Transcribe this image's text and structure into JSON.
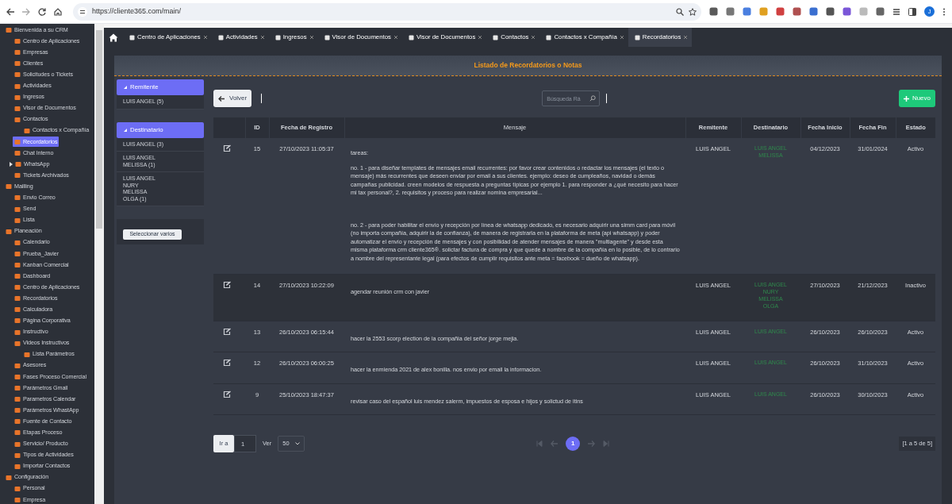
{
  "browser": {
    "url": "https://cliente365.com/main/",
    "profile": "J"
  },
  "sidebar": {
    "items": [
      {
        "label": "Bienvenida a su CRM",
        "selected": false,
        "expanded": true,
        "children": [
          {
            "label": "Centro de Aplicaciones",
            "selected": false
          },
          {
            "label": "Empresas",
            "selected": false
          },
          {
            "label": "Clientes",
            "selected": false
          },
          {
            "label": "Solicitudes o Tickets",
            "selected": false
          },
          {
            "label": "Actividades",
            "selected": false
          },
          {
            "label": "Ingresos",
            "selected": false
          },
          {
            "label": "Visor de Documentos",
            "selected": false
          },
          {
            "label": "Contactos",
            "selected": false,
            "expanded": true,
            "children": [
              {
                "label": "Contactos x Compañía",
                "selected": false
              }
            ]
          },
          {
            "label": "Recordatorios",
            "selected": true
          },
          {
            "label": "Chat Interno",
            "selected": false
          },
          {
            "label": "WhatsApp",
            "selected": false,
            "expanded": false
          },
          {
            "label": "Tickets Archivados",
            "selected": false
          }
        ]
      },
      {
        "label": "Mailling",
        "selected": false,
        "expanded": true,
        "children": [
          {
            "label": "Envio Correo",
            "selected": false
          },
          {
            "label": "Send",
            "selected": false
          },
          {
            "label": "Lista",
            "selected": false
          }
        ]
      },
      {
        "label": "Planeación",
        "selected": false,
        "expanded": true,
        "children": [
          {
            "label": "Calendario",
            "selected": false
          },
          {
            "label": "Prueba_Javier",
            "selected": false
          },
          {
            "label": "Kanban Comercial",
            "selected": false
          },
          {
            "label": "Dashboard",
            "selected": false
          },
          {
            "label": "Centro de Aplicaciones",
            "selected": false
          },
          {
            "label": "Recordatorios",
            "selected": false
          },
          {
            "label": "Calculadora",
            "selected": false
          },
          {
            "label": "Página Corporativa",
            "selected": false
          },
          {
            "label": "Instructivo",
            "selected": false
          },
          {
            "label": "Videos Instructivos",
            "selected": false,
            "expanded": true,
            "children": [
              {
                "label": "Lista Parámetros",
                "selected": false
              }
            ]
          },
          {
            "label": "Asesores",
            "selected": false
          },
          {
            "label": "Fases Proceso Comercial",
            "selected": false
          },
          {
            "label": "Parámetros Gmail",
            "selected": false
          },
          {
            "label": "Parametros Calendar",
            "selected": false
          },
          {
            "label": "Parámetros WhastApp",
            "selected": false
          },
          {
            "label": "Fuente de Contacto",
            "selected": false
          },
          {
            "label": "Etapas Proceso",
            "selected": false
          },
          {
            "label": "Servicio/ Producto",
            "selected": false
          },
          {
            "label": "Tipos de Actividades",
            "selected": false
          },
          {
            "label": "Importar Contactos",
            "selected": false
          }
        ]
      },
      {
        "label": "Configuración",
        "selected": false,
        "expanded": true,
        "children": [
          {
            "label": "Personal",
            "selected": false
          },
          {
            "label": "Empresa",
            "selected": false
          }
        ]
      }
    ]
  },
  "tabs": [
    {
      "label": "Centro de Aplicaciones",
      "selected": false
    },
    {
      "label": "Actividades",
      "selected": false
    },
    {
      "label": "Ingresos",
      "selected": false
    },
    {
      "label": "Visor de Documentos",
      "selected": false
    },
    {
      "label": "Visor de Documentos",
      "selected": false
    },
    {
      "label": "Contactos",
      "selected": false
    },
    {
      "label": "Contactos x Compañía",
      "selected": false
    },
    {
      "label": "Recordatorios",
      "selected": true
    }
  ],
  "panel_title": "Listado de Recordatorios o Notas",
  "filters": [
    {
      "title": "Remitente",
      "items": [
        "LUIS ANGEL  (5)"
      ]
    },
    {
      "title": "Destinatario",
      "items": [
        "LUIS ANGEL  (3)",
        "LUIS ANGEL\nMELISSA  (1)",
        "LUIS ANGEL\nNURY\nMELISSA\nOLGA  (1)"
      ]
    }
  ],
  "select_many_button": "Seleccionar varios",
  "back_button": "Volver",
  "search": {
    "placeholder": "Búsqueda Rá"
  },
  "new_button": "Nuevo",
  "table": {
    "columns": [
      "ID",
      "Fecha de Registro",
      "Mensaje",
      "Remitente",
      "Destinatario",
      "Fecha Inicio",
      "Fecha Fin",
      "Estado"
    ],
    "rows": [
      {
        "selected": false,
        "id": "15",
        "fecha_registro": "27/10/2023 11:05:37",
        "mensaje": [
          "tareas:",
          "no. 1 - para diseñar templates de mensajes email recurrentes: por favor crear contenidos o redactar los mensajes (el texto o mensaje)  más recurrentes que deseen enviar por email a sus clientes. ejemplo: deseo de cumpleaños, navidad o demás campañas publicidad. creen modelos de respuesta a preguntas típicas por ejemplo 1. para responder a ¿qué necesito para hacer mi tax personal?, 2. requisitos y proceso para realizar nomina empresarial...",
          "no. 2 - para poder habilitar el envío y recepción por línea de whatsapp dedicado, es necesario adquirir una simm card para móvil (no importa compañía, adquirir la de confianza), de manera de registrarla en la plataforma de meta (api whatsapp) y poder automatizar el envío y recepción de mensajes y con posibilidad de atender mensajes de manera \"multiagente\" y desde esta misma plataforma crm cliente365®. solictar factura de compra y que quede a nombre de la compañía en lo posible, de lo contrario a nombre del representante legal (para efectos de cumplir requisitos ante meta = facebook = dueño de  whatsapp)."
        ],
        "remitente": "LUIS ANGEL",
        "destinatario": [
          "LUIS ANGEL",
          "MELISSA"
        ],
        "fecha_inicio": "04/12/2023",
        "fecha_fin": "31/01/2024",
        "estado": "Activo"
      },
      {
        "selected": true,
        "id": "14",
        "fecha_registro": "27/10/2023 10:22:09",
        "mensaje": [
          "agendar reunión crm con javier"
        ],
        "remitente": "LUIS ANGEL",
        "destinatario": [
          "LUIS ANGEL",
          "NURY",
          "MELISSA",
          "OLGA"
        ],
        "fecha_inicio": "27/10/2023",
        "fecha_fin": "21/12/2023",
        "estado": "Inactivo"
      },
      {
        "selected": false,
        "id": "13",
        "fecha_registro": "26/10/2023 06:15:44",
        "mensaje": [
          "hacer la 2553 scorp election de la compañia del señor jorge mejia."
        ],
        "remitente": "LUIS ANGEL",
        "destinatario": [
          "LUIS ANGEL"
        ],
        "fecha_inicio": "26/10/2023",
        "fecha_fin": "26/10/2023",
        "estado": "Activo"
      },
      {
        "selected": false,
        "id": "12",
        "fecha_registro": "26/10/2023 06:00:25",
        "mensaje": [
          "hacer la enmienda 2021 de alex bonilla. nos envio por email la informacion."
        ],
        "remitente": "LUIS ANGEL",
        "destinatario": [
          "LUIS ANGEL"
        ],
        "fecha_inicio": "26/10/2023",
        "fecha_fin": "31/10/2023",
        "estado": "Activo"
      },
      {
        "selected": false,
        "id": "9",
        "fecha_registro": "25/10/2023 18:47:37",
        "mensaje": [
          "revisar caso del español luis mendez salerm, impuestos de esposa e hijos y solictud de itins"
        ],
        "remitente": "LUIS ANGEL",
        "destinatario": [
          "LUIS ANGEL"
        ],
        "fecha_inicio": "26/10/2023",
        "fecha_fin": "30/10/2023",
        "estado": "Activo"
      }
    ]
  },
  "pagination": {
    "goto_button": "Ir a",
    "page_input": "1",
    "view_label": "Ver",
    "page_size": "50",
    "pages": [
      {
        "label": "1",
        "selected": true
      }
    ],
    "summary": "[1 a 5 de 5]"
  }
}
